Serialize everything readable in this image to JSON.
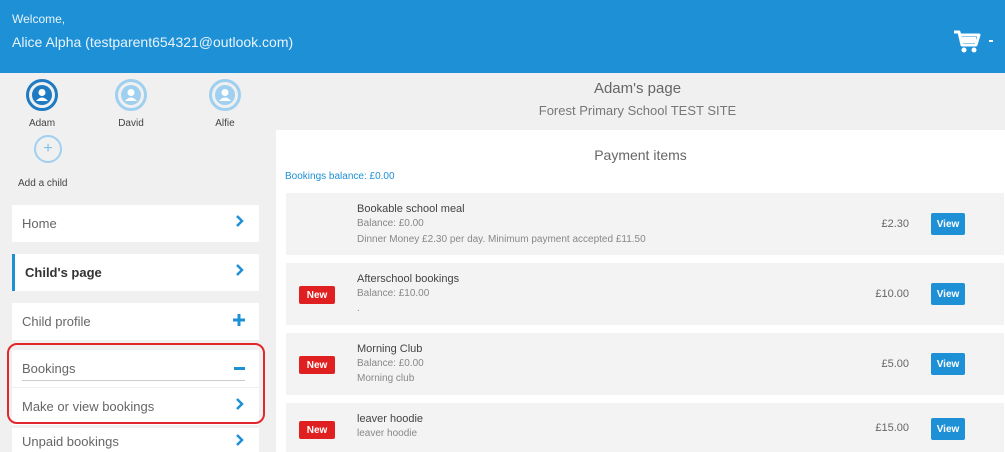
{
  "header": {
    "welcome": "Welcome,",
    "user": "Alice Alpha (testparent654321@outlook.com)",
    "cart_icon": "cart-icon"
  },
  "children": [
    {
      "name": "Adam",
      "active": true
    },
    {
      "name": "David",
      "active": false
    },
    {
      "name": "Alfie",
      "active": false
    }
  ],
  "add_child_label": "Add a child",
  "menu": {
    "home": "Home",
    "childs_page": "Child's page",
    "child_profile": "Child profile",
    "bookings": "Bookings",
    "make_or_view": "Make or view bookings",
    "unpaid": "Unpaid bookings"
  },
  "main": {
    "page_title": "Adam's page",
    "school": "Forest Primary School TEST SITE",
    "payment_heading": "Payment items",
    "bookings_balance": "Bookings balance: £0.00"
  },
  "badge_new": "New",
  "view_label": "View",
  "items": [
    {
      "title": "Bookable school meal",
      "balance": "Balance: £0.00",
      "detail": "Dinner Money £2.30 per day. Minimum payment accepted £11.50",
      "price": "£2.30",
      "is_new": false
    },
    {
      "title": "Afterschool bookings",
      "balance": "Balance: £10.00",
      "detail": ".",
      "price": "£10.00",
      "is_new": true
    },
    {
      "title": "Morning Club",
      "balance": "Balance: £0.00",
      "detail": "Morning club",
      "price": "£5.00",
      "is_new": true
    },
    {
      "title": "leaver hoodie",
      "balance": "leaver hoodie",
      "detail": "",
      "price": "£15.00",
      "is_new": true
    }
  ],
  "colors": {
    "header_blue": "#1e90d6",
    "badge_red": "#e02020",
    "highlight_red": "#e3262e"
  }
}
